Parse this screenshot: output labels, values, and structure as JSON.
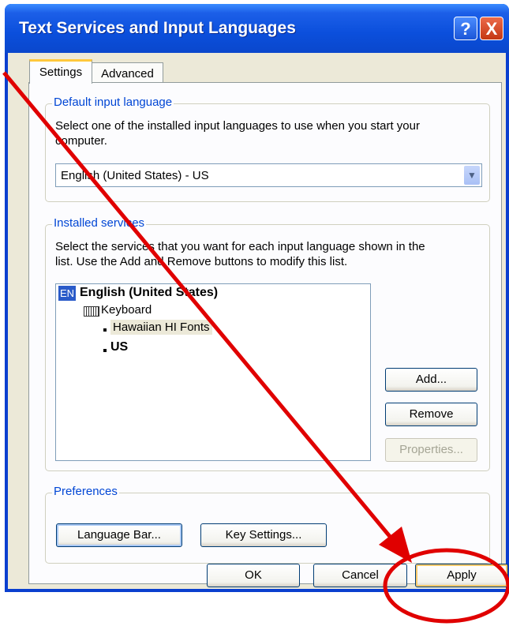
{
  "window": {
    "title": "Text Services and Input Languages",
    "help_glyph": "?",
    "close_glyph": "X"
  },
  "tabs": [
    {
      "label": "Settings",
      "selected": true
    },
    {
      "label": "Advanced",
      "selected": false
    }
  ],
  "default_input": {
    "legend": "Default input language",
    "description_line1": "Select one of the installed input languages to use when you start your",
    "description_line2": "computer.",
    "selected_value": "English (United States) - US",
    "arrow_glyph": "▼"
  },
  "installed_services": {
    "legend": "Installed services",
    "description_line1": "Select the services that you want for each input language shown in the",
    "description_line2": "list. Use the Add and Remove buttons to modify this list.",
    "tree": {
      "badge": "EN",
      "language": "English (United States)",
      "category": "Keyboard",
      "layouts": [
        "Hawaiian HI Fonts",
        "US"
      ]
    },
    "buttons": {
      "add": "Add...",
      "remove": "Remove",
      "properties": "Properties..."
    }
  },
  "preferences": {
    "legend": "Preferences",
    "language_bar_button": "Language Bar...",
    "key_settings_button": "Key Settings..."
  },
  "footer": {
    "ok": "OK",
    "cancel": "Cancel",
    "apply": "Apply"
  },
  "colors": {
    "titlebar": "#0a47cc",
    "legend_text": "#0046d5",
    "annotation": "#e00000"
  }
}
